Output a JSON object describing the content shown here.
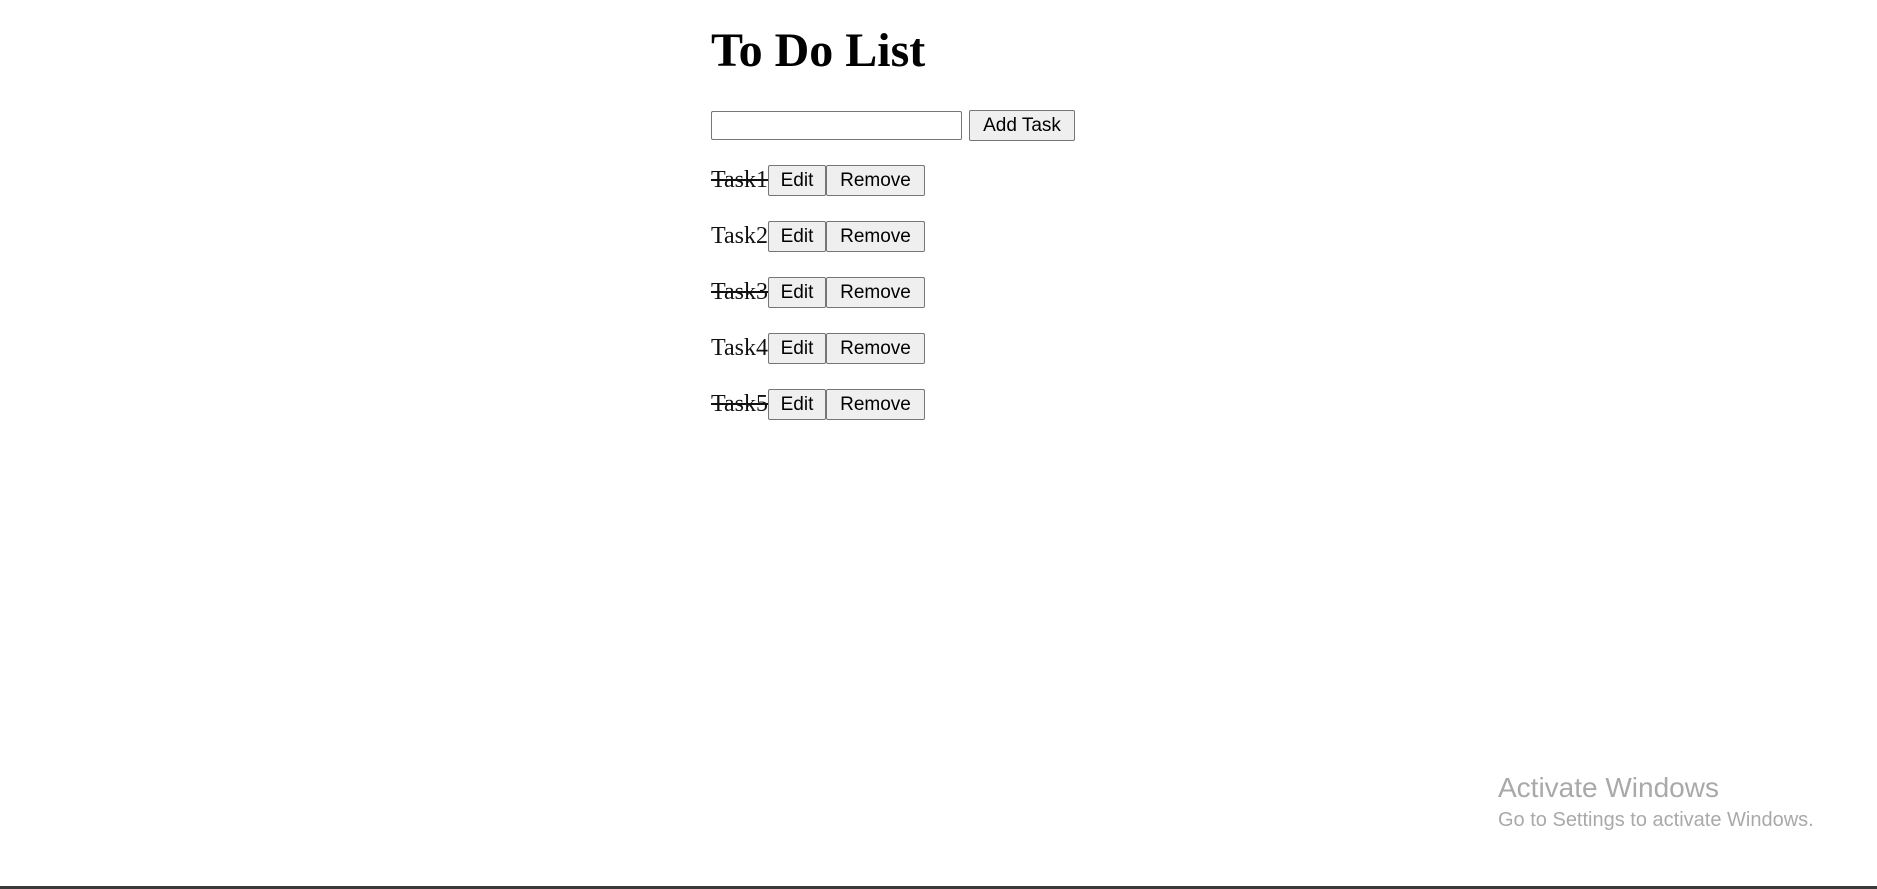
{
  "page": {
    "title": "To Do List"
  },
  "add_form": {
    "input_value": "",
    "input_placeholder": "",
    "add_button_label": "Add Task"
  },
  "tasks": [
    {
      "text": "Task1",
      "completed": true,
      "edit_label": "Edit",
      "remove_label": "Remove"
    },
    {
      "text": "Task2",
      "completed": false,
      "edit_label": "Edit",
      "remove_label": "Remove"
    },
    {
      "text": "Task3",
      "completed": true,
      "edit_label": "Edit",
      "remove_label": "Remove"
    },
    {
      "text": "Task4",
      "completed": false,
      "edit_label": "Edit",
      "remove_label": "Remove"
    },
    {
      "text": "Task5",
      "completed": true,
      "edit_label": "Edit",
      "remove_label": "Remove"
    }
  ],
  "watermark": {
    "title": "Activate Windows",
    "subtitle": "Go to Settings to activate Windows."
  }
}
